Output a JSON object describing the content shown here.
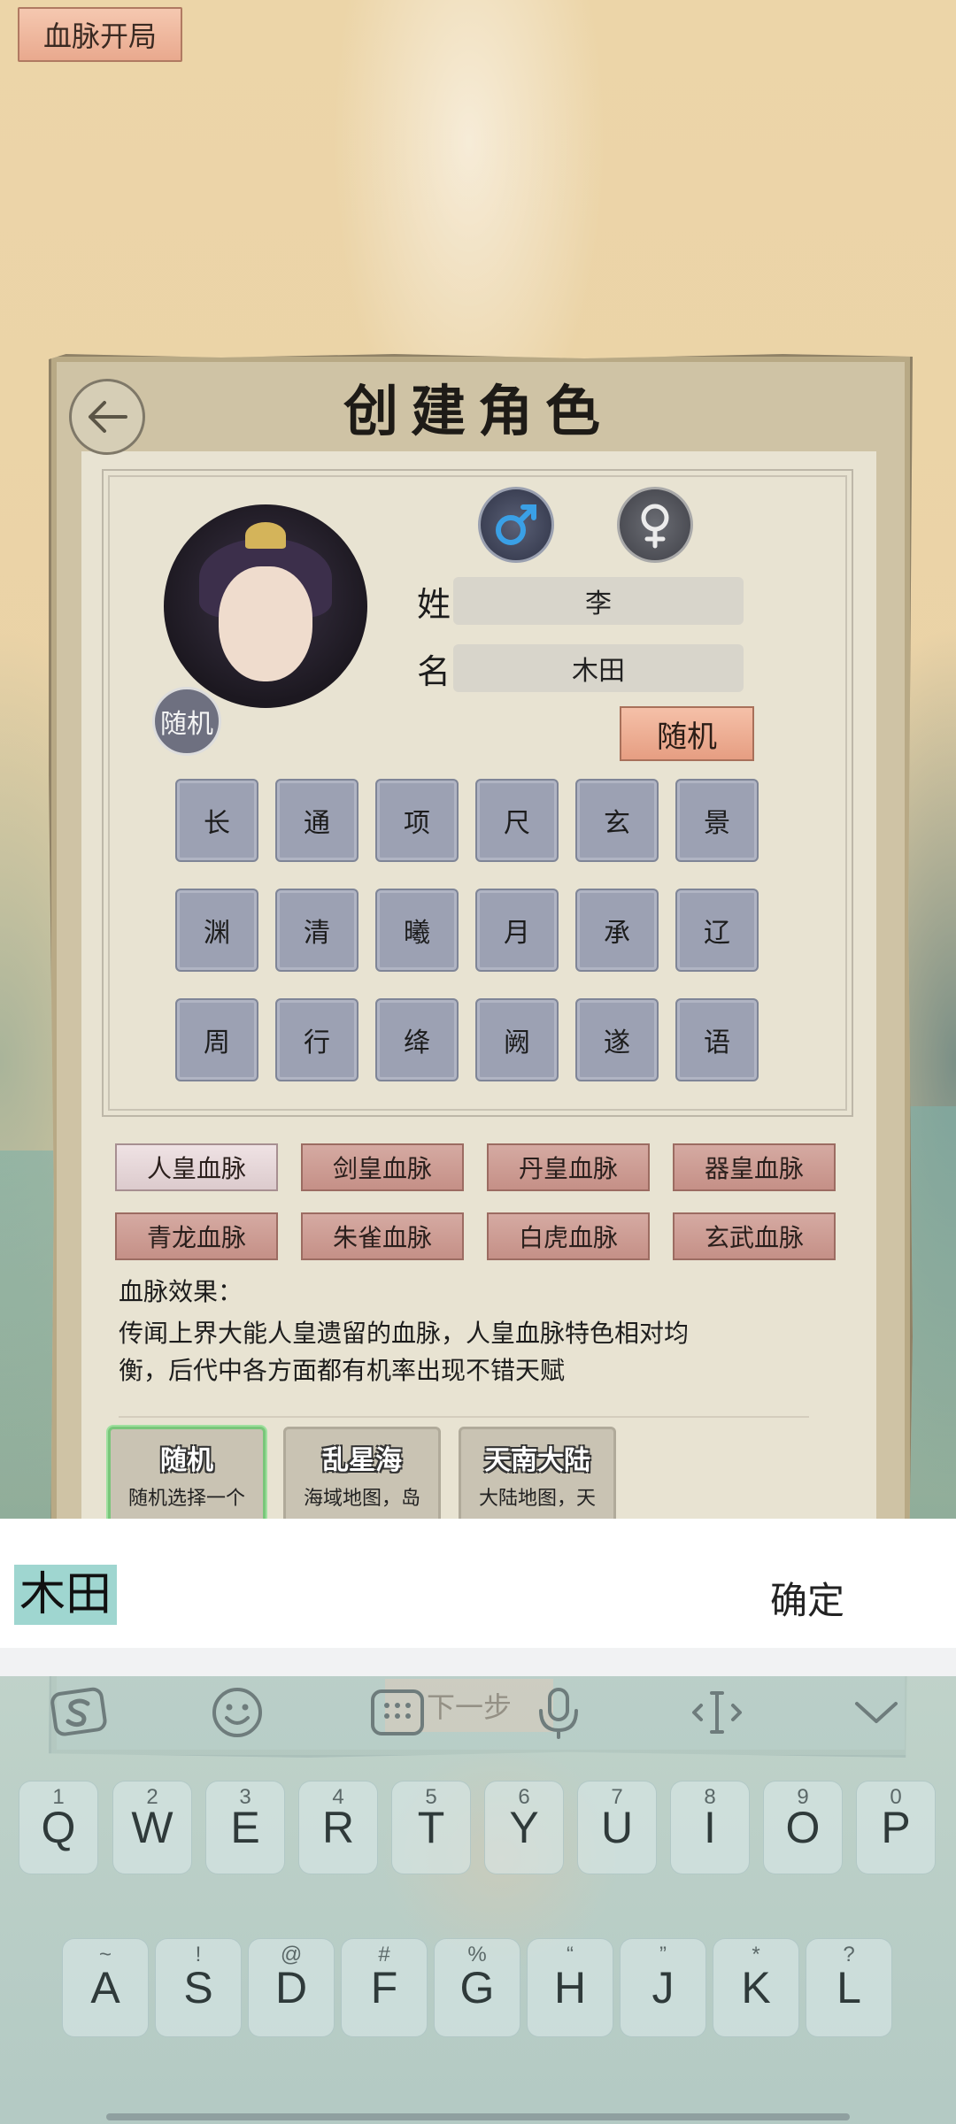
{
  "top_button": "血脉开局",
  "dialog": {
    "title": "创建角色",
    "avatar_badge": "随机",
    "surname_label": "姓",
    "surname_value": "李",
    "given_label": "名",
    "given_value": "木田",
    "random_button": "随机",
    "name_chars": [
      "长",
      "通",
      "项",
      "尺",
      "玄",
      "景",
      "渊",
      "清",
      "曦",
      "月",
      "承",
      "辽",
      "周",
      "行",
      "绛",
      "阙",
      "遂",
      "语"
    ],
    "bloodlines": [
      "人皇血脉",
      "剑皇血脉",
      "丹皇血脉",
      "器皇血脉",
      "青龙血脉",
      "朱雀血脉",
      "白虎血脉",
      "玄武血脉"
    ],
    "selected_bloodline": "人皇血脉",
    "effect_label": "血脉效果：",
    "effect_line1": "传闻上界大能人皇遗留的血脉，人皇血脉特色相对均",
    "effect_line2": "衡，后代中各方面都有机率出现不错天赋",
    "maps": [
      {
        "title": "随机",
        "desc": "随机选择一个"
      },
      {
        "title": "乱星海",
        "desc": "海域地图，岛"
      },
      {
        "title": "天南大陆",
        "desc": "大陆地图，天"
      }
    ],
    "next_step": "下一步"
  },
  "ime": {
    "composing_text": "木田",
    "confirm": "确定"
  },
  "keyboard": {
    "row1": [
      {
        "key": "Q",
        "sub": "1"
      },
      {
        "key": "W",
        "sub": "2"
      },
      {
        "key": "E",
        "sub": "3"
      },
      {
        "key": "R",
        "sub": "4"
      },
      {
        "key": "T",
        "sub": "5"
      },
      {
        "key": "Y",
        "sub": "6"
      },
      {
        "key": "U",
        "sub": "7"
      },
      {
        "key": "I",
        "sub": "8"
      },
      {
        "key": "O",
        "sub": "9"
      },
      {
        "key": "P",
        "sub": "0"
      }
    ],
    "row2": [
      {
        "key": "A",
        "sub": "~"
      },
      {
        "key": "S",
        "sub": "!"
      },
      {
        "key": "D",
        "sub": "@"
      },
      {
        "key": "F",
        "sub": "#"
      },
      {
        "key": "G",
        "sub": "%"
      },
      {
        "key": "H",
        "sub": "“"
      },
      {
        "key": "J",
        "sub": "”"
      },
      {
        "key": "K",
        "sub": "*"
      },
      {
        "key": "L",
        "sub": "?"
      }
    ]
  }
}
